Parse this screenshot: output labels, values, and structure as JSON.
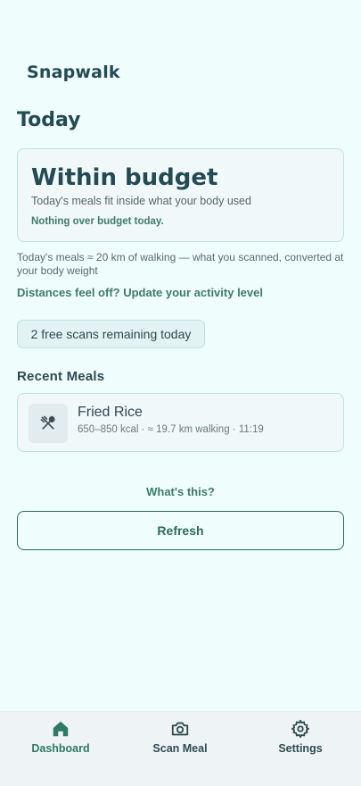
{
  "app": {
    "title": "Snapwalk"
  },
  "page": {
    "title": "Today"
  },
  "budget": {
    "headline": "Within budget",
    "subtitle": "Today's meals fit inside what your body used",
    "note": "Nothing over budget today."
  },
  "walking_summary": "Today's meals ≈ 20 km of walking — what you scanned, converted at your body weight",
  "activity_link": "Distances feel off? Update your activity level",
  "scans_remaining": "2 free scans remaining today",
  "recent_meals": {
    "title": "Recent Meals",
    "items": [
      {
        "name": "Fried Rice",
        "meta": "650–850 kcal · ≈ 19.7 km walking · 11:19",
        "icon": "fork-knife-icon"
      }
    ]
  },
  "help_link": "What's this?",
  "refresh_label": "Refresh",
  "tabs": [
    {
      "label": "Dashboard",
      "icon": "home-icon",
      "active": true
    },
    {
      "label": "Scan Meal",
      "icon": "camera-icon",
      "active": false
    },
    {
      "label": "Settings",
      "icon": "gear-icon",
      "active": false
    }
  ],
  "colors": {
    "background": "#effdfc",
    "accent": "#2f7a64",
    "text": "#234a55",
    "card_border": "#b8e4e1"
  }
}
